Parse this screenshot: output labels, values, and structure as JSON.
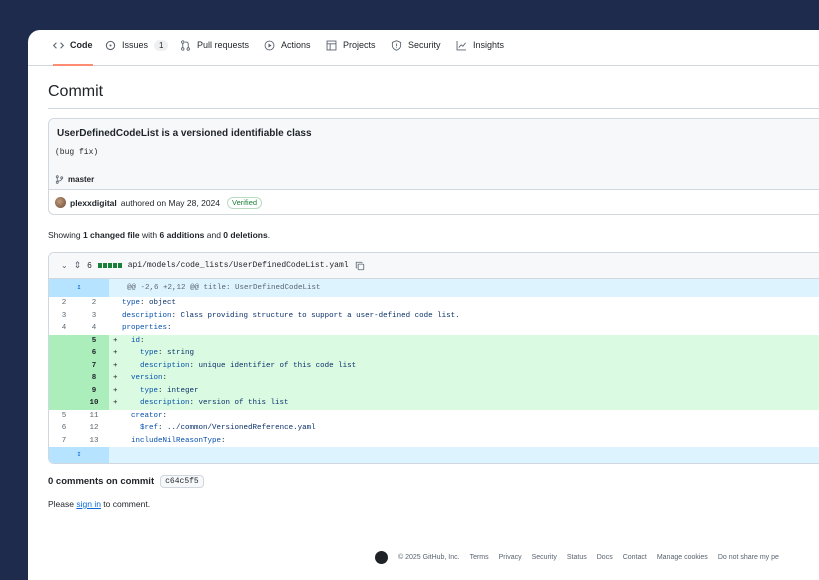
{
  "tabs": [
    {
      "label": "Code",
      "icon": "code-icon",
      "active": true
    },
    {
      "label": "Issues",
      "icon": "issue-icon",
      "count": "1"
    },
    {
      "label": "Pull requests",
      "icon": "pull-request-icon"
    },
    {
      "label": "Actions",
      "icon": "play-icon"
    },
    {
      "label": "Projects",
      "icon": "table-icon"
    },
    {
      "label": "Security",
      "icon": "shield-icon"
    },
    {
      "label": "Insights",
      "icon": "graph-icon"
    }
  ],
  "page_title": "Commit",
  "commit": {
    "title": "UserDefinedCodeList is a versioned identifiable class",
    "body": "(bug fix)",
    "branch": "master",
    "author": "plexxdigital",
    "authored_text": "authored on May 28, 2024",
    "verified": "Verified"
  },
  "summary": {
    "pre": "Showing ",
    "files": "1 changed file",
    "mid": " with ",
    "additions": "6 additions",
    "and": " and ",
    "deletions": "0 deletions",
    "end": "."
  },
  "diff": {
    "count": "6",
    "path": "api/models/code_lists/UserDefinedCodeList.yaml",
    "hunk": "@@ -2,6 +2,12 @@ title: UserDefinedCodeList",
    "lines": [
      {
        "type": "ctx",
        "old": "2",
        "new": "2",
        "key": "type",
        "val": " object",
        "indent": ""
      },
      {
        "type": "ctx",
        "old": "3",
        "new": "3",
        "key": "description",
        "val": " Class providing structure to support a user-defined code list.",
        "indent": ""
      },
      {
        "type": "ctx",
        "old": "4",
        "new": "4",
        "key": "properties",
        "val": "",
        "indent": ""
      },
      {
        "type": "add",
        "old": "",
        "new": "5",
        "key": "id",
        "val": "",
        "indent": "  "
      },
      {
        "type": "add",
        "old": "",
        "new": "6",
        "key": "type",
        "val": " string",
        "indent": "    "
      },
      {
        "type": "add",
        "old": "",
        "new": "7",
        "key": "description",
        "val": " unique identifier of this code list",
        "indent": "    "
      },
      {
        "type": "add",
        "old": "",
        "new": "8",
        "key": "version",
        "val": "",
        "indent": "  "
      },
      {
        "type": "add",
        "old": "",
        "new": "9",
        "key": "type",
        "val": " integer",
        "indent": "    "
      },
      {
        "type": "add",
        "old": "",
        "new": "10",
        "key": "description",
        "val": " version of this list",
        "indent": "    "
      },
      {
        "type": "ctx",
        "old": "5",
        "new": "11",
        "key": "creator",
        "val": "",
        "indent": "  "
      },
      {
        "type": "ctx",
        "old": "6",
        "new": "12",
        "key": "$ref",
        "val": " ../common/VersionedReference.yaml",
        "indent": "    "
      },
      {
        "type": "ctx",
        "old": "7",
        "new": "13",
        "key": "includeNilReasonType",
        "val": "",
        "indent": "  "
      }
    ]
  },
  "comments": {
    "title": "0 comments on commit",
    "sha": "c64c5f5",
    "signin_link": "sign in",
    "signin_rest": " to comment.",
    "please": "Please "
  },
  "footer": {
    "copyright": "© 2025 GitHub, Inc.",
    "links": [
      "Terms",
      "Privacy",
      "Security",
      "Status",
      "Docs",
      "Contact",
      "Manage cookies",
      "Do not share my pe"
    ]
  }
}
